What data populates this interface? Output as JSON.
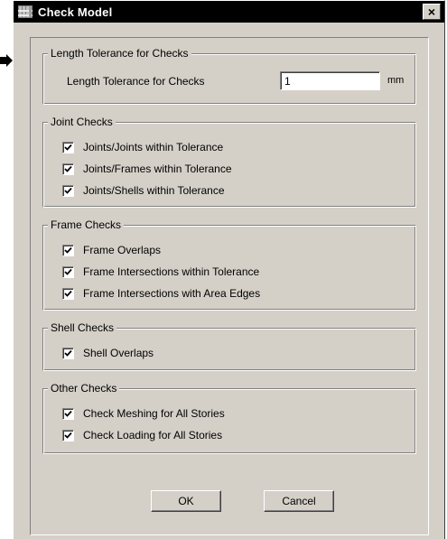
{
  "window": {
    "title": "Check Model",
    "close_label": "×",
    "title_icon": "app-icon"
  },
  "groups": {
    "length": {
      "legend": "Length Tolerance for Checks",
      "field_label": "Length Tolerance for Checks",
      "value": "1",
      "unit": "mm"
    },
    "joint": {
      "legend": "Joint Checks",
      "items": [
        {
          "label": "Joints/Joints within Tolerance",
          "checked": true
        },
        {
          "label": "Joints/Frames within Tolerance",
          "checked": true
        },
        {
          "label": "Joints/Shells within Tolerance",
          "checked": true
        }
      ]
    },
    "frame": {
      "legend": "Frame Checks",
      "items": [
        {
          "label": "Frame Overlaps",
          "checked": true
        },
        {
          "label": "Frame Intersections within Tolerance",
          "checked": true
        },
        {
          "label": "Frame Intersections with Area Edges",
          "checked": true
        }
      ]
    },
    "shell": {
      "legend": "Shell Checks",
      "items": [
        {
          "label": "Shell Overlaps",
          "checked": true
        }
      ]
    },
    "other": {
      "legend": "Other Checks",
      "items": [
        {
          "label": "Check Meshing for All Stories",
          "checked": true
        },
        {
          "label": "Check Loading for All Stories",
          "checked": true
        }
      ]
    }
  },
  "buttons": {
    "ok_label": "OK",
    "cancel_label": "Cancel"
  },
  "colors": {
    "face": "#d4d0c8",
    "titlebar": "#000000"
  }
}
